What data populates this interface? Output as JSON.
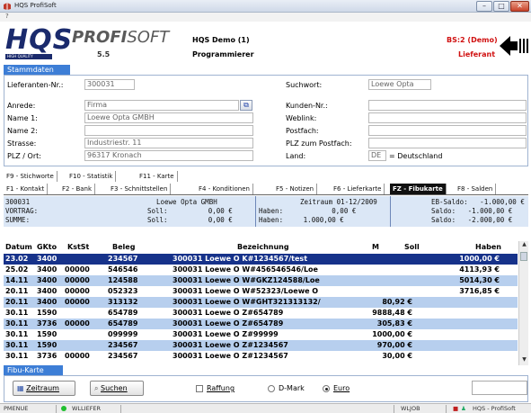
{
  "window": {
    "title": "HQS ProfiSoft",
    "menu_hint": "?",
    "buttons": [
      "–",
      "□",
      "✕"
    ]
  },
  "header": {
    "logo_main": "HQS",
    "logo_sub": "HIGH QUALITY SOFTWARE",
    "logo_profi_bold": "PROFI",
    "logo_profi_thin": "SOFT",
    "version": "5.5",
    "company": "HQS Demo (1)",
    "user": "Programmierer",
    "bs_label": "BS:2 (Demo)",
    "bs_sub": "Lieferant"
  },
  "stammdaten": {
    "section_label": "Stammdaten",
    "lieferant_label": "Lieferanten-Nr.:",
    "lieferant_value": "300031",
    "anrede_label": "Anrede:",
    "anrede_value": "Firma",
    "name1_label": "Name 1:",
    "name1_value": "Loewe Opta GMBH",
    "name2_label": "Name 2:",
    "name2_value": "",
    "strasse_label": "Strasse:",
    "strasse_value": "Industriestr. 11",
    "plz_label": "PLZ / Ort:",
    "plz_value": "96317 Kronach",
    "suchwort_label": "Suchwort:",
    "suchwort_value": "Loewe Opta",
    "kunden_label": "Kunden-Nr.:",
    "kunden_value": "",
    "weblink_label": "Weblink:",
    "weblink_value": "",
    "postfach_label": "Postfach:",
    "postfach_value": "",
    "plz_postfach_label": "PLZ zum Postfach:",
    "plz_postfach_value": "",
    "land_label": "Land:",
    "land_code": "DE",
    "land_name": "= Deutschland"
  },
  "tabs_row1": [
    "F9 - Stichworte",
    "F10 - Statistik",
    "F11 - Karte"
  ],
  "tabs_row2": [
    "F1 - Kontakt",
    "F2 - Bank",
    "F3 - Schnittstellen",
    "F4 - Konditionen",
    "F5 - Notizen",
    "F6 - Lieferkarte",
    "FZ - Fibukarte",
    "F8 - Salden"
  ],
  "active_tab": "FZ - Fibukarte",
  "summary": {
    "r1c1": "300031",
    "r1c2": "Loewe Opta GMBH",
    "r1c3": "Zeitraum 01-12/2009",
    "r1c4": "EB-Saldo:   -1.000,00 €",
    "r2c1": "VORTRAG:",
    "r2c2": "Soll:          0,00 €",
    "r2c3": "Haben:            0,00 €",
    "r2c4": "Saldo:   -1.000,00 €",
    "r3c1": "SUMME:",
    "r3c2": "Soll:          0,00 €",
    "r3c3": "Haben:     1.000,00 €",
    "r3c4": "Saldo:   -2.000,00 €"
  },
  "table": {
    "headers": [
      "Datum",
      "GKto",
      "KstSt",
      "Beleg",
      "Bezeichnung",
      "M",
      "Soll",
      "Haben"
    ],
    "rows": [
      [
        "23.02",
        "3400",
        "",
        "234567",
        "300031 Loewe O K#1234567/test",
        "",
        "",
        "1000,00 €"
      ],
      [
        "25.02",
        "3400",
        "00000",
        "546546",
        "300031 Loewe O W#456546546/Loe",
        "",
        "",
        "4113,93 €"
      ],
      [
        "14.11",
        "3400",
        "00000",
        "124588",
        "300031 Loewe O W#GKZ124588/Loe",
        "",
        "",
        "5014,30 €"
      ],
      [
        "20.11",
        "3400",
        "00000",
        "052323",
        "300031 Loewe O W#52323/Loewe O",
        "",
        "",
        "3716,85 €"
      ],
      [
        "20.11",
        "3400",
        "00000",
        "313132",
        "300031 Loewe O W#GHT321313132/",
        "",
        "",
        ""
      ],
      [
        "30.11",
        "1590",
        "",
        "654789",
        "300031 Loewe O Z#654789",
        "",
        "9888,48 €",
        ""
      ],
      [
        "30.11",
        "3736",
        "00000",
        "654789",
        "300031 Loewe O Z#654789",
        "",
        "305,83 €",
        ""
      ],
      [
        "30.11",
        "1590",
        "",
        "099999",
        "300031 Loewe O Z#99999",
        "",
        "1000,00 €",
        ""
      ],
      [
        "30.11",
        "1590",
        "",
        "234567",
        "300031 Loewe O Z#1234567",
        "",
        "970,00 €",
        ""
      ],
      [
        "30.11",
        "3736",
        "00000",
        "234567",
        "300031 Loewe O Z#1234567",
        "",
        "30,00 €",
        ""
      ]
    ],
    "extra_soll_row5": "80,92 €"
  },
  "fibu": {
    "section_label": "Fibu-Karte",
    "zeitraum_label": "Zeitraum",
    "suchen_label": "Suchen",
    "raffung_label": "Raffung",
    "dmark_label": "D-Mark",
    "euro_label": "Euro"
  },
  "status": {
    "s1": "PMENUE",
    "s2": "WLLIEFER",
    "s3": "WLJOB",
    "s4": "HQS - ProfiSoft"
  },
  "colors": {
    "accent": "#3d7ed6",
    "selected_row": "#16328a",
    "alt_row": "#b7cfee",
    "summary_bg": "#dbe7f6",
    "red_text": "#d01010"
  }
}
